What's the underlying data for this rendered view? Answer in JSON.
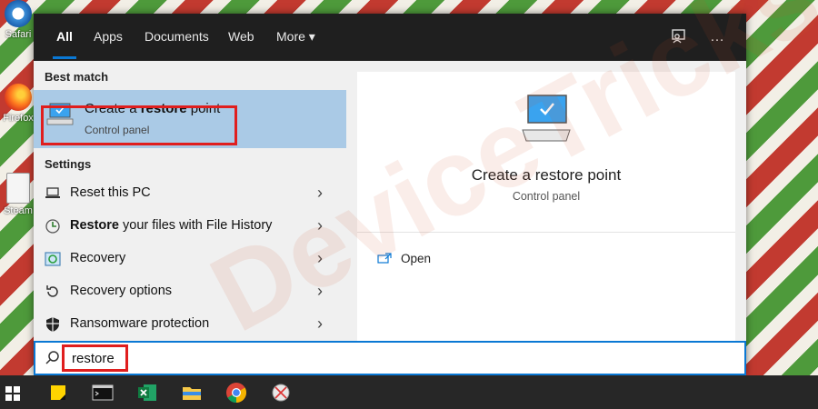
{
  "desktop": {
    "icons": [
      {
        "label": "Safari",
        "icon": "safari-icon"
      },
      {
        "label": "Firefox",
        "icon": "firefox-icon"
      },
      {
        "label": "Steam",
        "icon": "steam-icon"
      }
    ]
  },
  "topbar": {
    "tabs": [
      {
        "label": "All",
        "active": true
      },
      {
        "label": "Apps"
      },
      {
        "label": "Documents"
      },
      {
        "label": "Web"
      },
      {
        "label": "More ▾"
      }
    ],
    "feedback_icon": "feedback-icon",
    "more_icon": "…"
  },
  "left": {
    "best_match_title": "Best match",
    "best": {
      "title_prefix": "Create a ",
      "title_bold": "restore",
      "title_suffix": " point",
      "subtitle": "Control panel"
    },
    "settings_title": "Settings",
    "settings": [
      {
        "icon": "laptop-reset-icon",
        "bold": "",
        "label": "Reset this PC"
      },
      {
        "icon": "file-history-icon",
        "bold": "Restore",
        "label": " your files with File History"
      },
      {
        "icon": "recovery-icon",
        "bold": "",
        "label": "Recovery"
      },
      {
        "icon": "recovery-options-icon",
        "bold": "",
        "label": "Recovery options"
      },
      {
        "icon": "shield-icon",
        "bold": "",
        "label": "Ransomware protection"
      }
    ]
  },
  "right": {
    "title": "Create a restore point",
    "subtitle": "Control panel",
    "action_open": "Open"
  },
  "watermark": "DeviceTricks",
  "search": {
    "value": "restore"
  },
  "colors": {
    "accent": "#0a78d4",
    "highlight": "#aacae6",
    "annotation_red": "#e01e1e"
  }
}
